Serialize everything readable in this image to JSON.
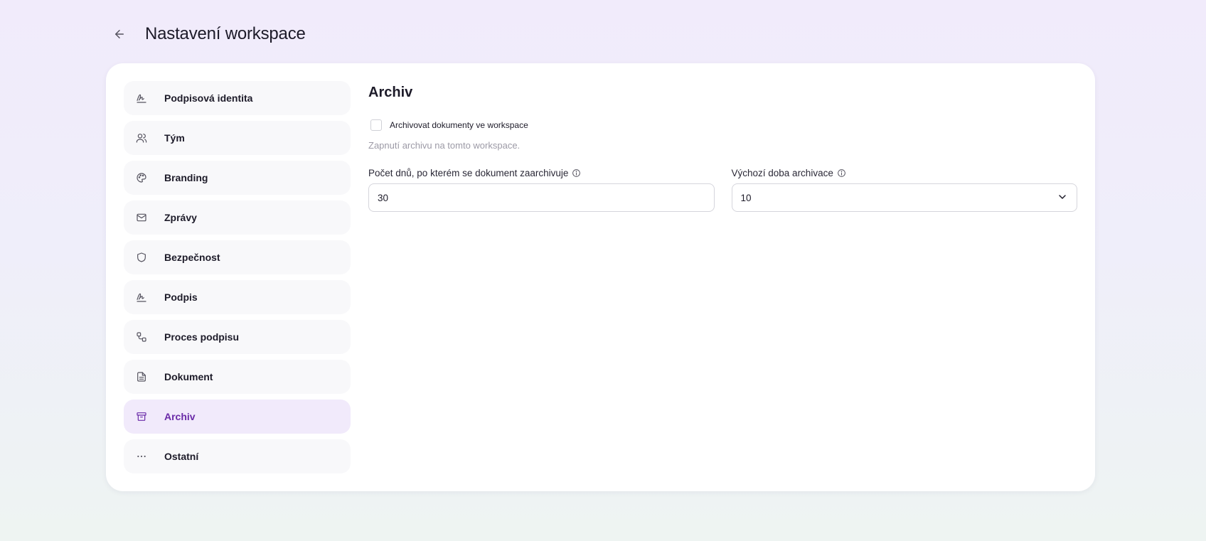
{
  "header": {
    "title": "Nastavení workspace"
  },
  "sidebar": {
    "items": [
      {
        "label": "Podpisová identita",
        "icon": "signature-icon",
        "active": false
      },
      {
        "label": "Tým",
        "icon": "users-icon",
        "active": false
      },
      {
        "label": "Branding",
        "icon": "palette-icon",
        "active": false
      },
      {
        "label": "Zprávy",
        "icon": "mail-icon",
        "active": false
      },
      {
        "label": "Bezpečnost",
        "icon": "shield-icon",
        "active": false
      },
      {
        "label": "Podpis",
        "icon": "signature-icon",
        "active": false
      },
      {
        "label": "Proces podpisu",
        "icon": "workflow-icon",
        "active": false
      },
      {
        "label": "Dokument",
        "icon": "document-icon",
        "active": false
      },
      {
        "label": "Archiv",
        "icon": "archive-icon",
        "active": true
      },
      {
        "label": "Ostatní",
        "icon": "more-icon",
        "active": false
      }
    ]
  },
  "archive": {
    "title": "Archiv",
    "checkbox_label": "Archivovat dokumenty ve workspace",
    "help_text": "Zapnutí archivu na tomto workspace.",
    "days_label": "Počet dnů, po kterém se dokument zaarchivuje",
    "days_value": "30",
    "duration_label": "Výchozí doba archivace",
    "duration_value": "10"
  },
  "colors": {
    "accent": "#6a2ba8",
    "active_bg": "#f1eafb",
    "item_bg": "#f8f8fa"
  }
}
